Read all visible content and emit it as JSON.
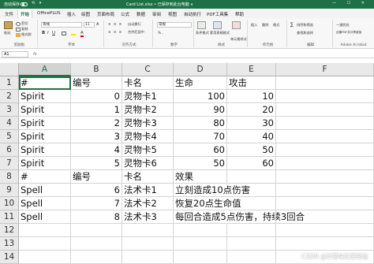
{
  "titlebar": {
    "autosave_label": "自动保存",
    "quick_access": "⟲ ▾",
    "filename": "Card List.xlsx • 已保存到此台电脑 ∨",
    "window_controls": "— ☐ ✕"
  },
  "ribbon": {
    "tabs": [
      "文件",
      "开始",
      "OfficePLUS",
      "插入",
      "绘图",
      "页面布局",
      "公式",
      "数据",
      "审阅",
      "视图",
      "自动执行",
      "PDF工具集",
      "帮助"
    ],
    "active_tab": "开始",
    "clipboard": {
      "paste": "粘贴",
      "cut": "剪切",
      "copy": "复制",
      "format_painter": "格式刷",
      "group": "剪贴板"
    },
    "font": {
      "name": "等线",
      "size": "11",
      "group": "字体"
    },
    "alignment": {
      "wrap": "自动换行",
      "merge": "合并后居中",
      "group": "对齐方式"
    },
    "number": {
      "format": "常规",
      "group": "数字"
    },
    "styles": {
      "conditional": "条件格式",
      "table": "套用表格格式",
      "cell": "单元格样式",
      "group": "样式"
    },
    "cells": {
      "insert": "插入",
      "delete": "删除",
      "format": "格式",
      "group": "单元格"
    },
    "editing": {
      "sum": "∑",
      "sort": "排序和筛选",
      "find": "查找和选择",
      "group": "编辑"
    },
    "extras": {
      "one_click": "一键优化",
      "acrobat": "创建PDF并共享链接",
      "group": "Adobe Acrobat"
    }
  },
  "formula_bar": {
    "name_box": "A1",
    "fx": "fx",
    "content": ""
  },
  "sheet": {
    "columns": [
      "A",
      "B",
      "C",
      "D",
      "E",
      "F"
    ],
    "selected_column": "A",
    "rows": [
      {
        "num": "1",
        "cells": [
          "#",
          "编号",
          "卡名",
          "生命",
          "攻击",
          ""
        ]
      },
      {
        "num": "2",
        "cells": [
          "Spirit",
          "0",
          "灵物卡1",
          "100",
          "10",
          ""
        ]
      },
      {
        "num": "3",
        "cells": [
          "Spirit",
          "1",
          "灵物卡2",
          "90",
          "20",
          ""
        ]
      },
      {
        "num": "4",
        "cells": [
          "Spirit",
          "2",
          "灵物卡3",
          "80",
          "30",
          ""
        ]
      },
      {
        "num": "5",
        "cells": [
          "Spirit",
          "3",
          "灵物卡4",
          "70",
          "40",
          ""
        ]
      },
      {
        "num": "6",
        "cells": [
          "Spirit",
          "4",
          "灵物卡5",
          "60",
          "50",
          ""
        ]
      },
      {
        "num": "7",
        "cells": [
          "Spirit",
          "5",
          "灵物卡6",
          "50",
          "60",
          ""
        ]
      },
      {
        "num": "8",
        "cells": [
          "#",
          "编号",
          "卡名",
          "效果",
          "",
          ""
        ]
      },
      {
        "num": "9",
        "cells": [
          "Spell",
          "6",
          "法术卡1",
          "立刻造成10点伤害",
          "",
          ""
        ]
      },
      {
        "num": "10",
        "cells": [
          "Spell",
          "7",
          "法术卡2",
          "恢复20点生命值",
          "",
          ""
        ]
      },
      {
        "num": "11",
        "cells": [
          "Spell",
          "8",
          "法术卡3",
          "每回合造成5点伤害，持续3回合",
          "",
          ""
        ]
      },
      {
        "num": "12",
        "cells": [
          "",
          "",
          "",
          "",
          "",
          ""
        ]
      },
      {
        "num": "13",
        "cells": [
          "",
          "",
          "",
          "",
          "",
          ""
        ]
      },
      {
        "num": "14",
        "cells": [
          "",
          "",
          "",
          "",
          "",
          ""
        ]
      }
    ]
  },
  "watermark": "CSDN @柠檬味的薄荷糖"
}
